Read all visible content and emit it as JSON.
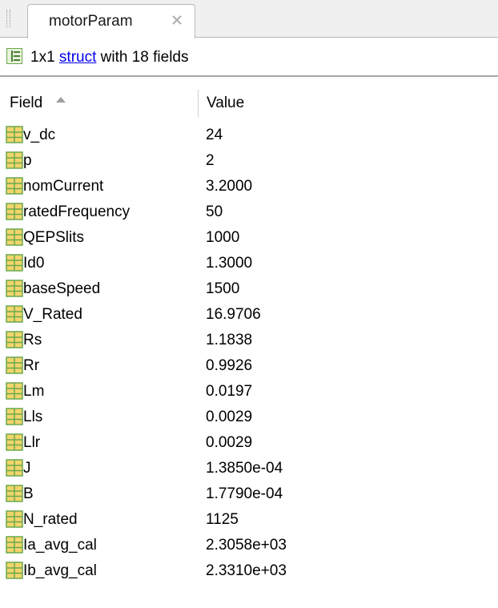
{
  "tab": {
    "label": "motorParam",
    "close_icon": "close-icon"
  },
  "info": {
    "icon": "struct-icon",
    "prefix": "1x1 ",
    "link": "struct",
    "suffix": " with 18 fields"
  },
  "header": {
    "field": "Field",
    "value": "Value",
    "sort_icon": "sort-ascending-icon"
  },
  "colors": {
    "icon_fill": "#f2d56b",
    "icon_grid": "#6aa84f",
    "link": "#0000ee"
  },
  "rows": [
    {
      "name": "v_dc",
      "value": "24"
    },
    {
      "name": "p",
      "value": "2"
    },
    {
      "name": "nomCurrent",
      "value": "3.2000"
    },
    {
      "name": "ratedFrequency",
      "value": "50"
    },
    {
      "name": "QEPSlits",
      "value": "1000"
    },
    {
      "name": "Id0",
      "value": "1.3000"
    },
    {
      "name": "baseSpeed",
      "value": "1500"
    },
    {
      "name": "V_Rated",
      "value": "16.9706"
    },
    {
      "name": "Rs",
      "value": "1.1838"
    },
    {
      "name": "Rr",
      "value": "0.9926"
    },
    {
      "name": "Lm",
      "value": "0.0197"
    },
    {
      "name": "Lls",
      "value": "0.0029"
    },
    {
      "name": "Llr",
      "value": "0.0029"
    },
    {
      "name": "J",
      "value": "1.3850e-04"
    },
    {
      "name": "B",
      "value": "1.7790e-04"
    },
    {
      "name": "N_rated",
      "value": "1125"
    },
    {
      "name": "Ia_avg_cal",
      "value": "2.3058e+03"
    },
    {
      "name": "Ib_avg_cal",
      "value": "2.3310e+03"
    }
  ]
}
